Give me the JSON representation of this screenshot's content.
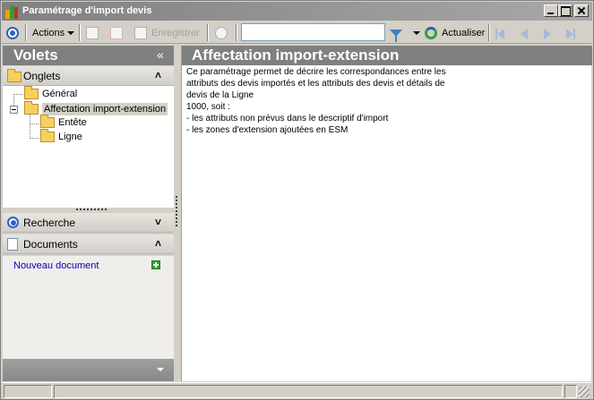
{
  "window": {
    "title": "Paramétrage d'import devis"
  },
  "toolbar": {
    "actions_label": "Actions",
    "save_label": "Enregistrer",
    "search_value": "",
    "refresh_label": "Actualiser"
  },
  "left": {
    "header": "Volets",
    "collapse_glyph": "«",
    "sections": {
      "onglets": "Onglets",
      "recherche": "Recherche",
      "documents": "Documents"
    },
    "tree": {
      "general": "Général",
      "affectation": "Affectation import-extension",
      "entete": "Entête",
      "ligne": "Ligne"
    },
    "new_document": "Nouveau document"
  },
  "right": {
    "header": "Affectation import-extension",
    "description": [
      "Ce paramétrage permet de décrire les correspondances entre les",
      "attributs des devis importés et les attributs des devis et détails de",
      "devis de la Ligne",
      "1000, soit :",
      "- les attributs non prévus dans le descriptif d'import",
      "- les zones d'extension ajoutées en ESM"
    ]
  },
  "colors": {
    "header_bg": "#808080",
    "link": "#0000c0",
    "selected_bg": "#d4d0c8"
  }
}
